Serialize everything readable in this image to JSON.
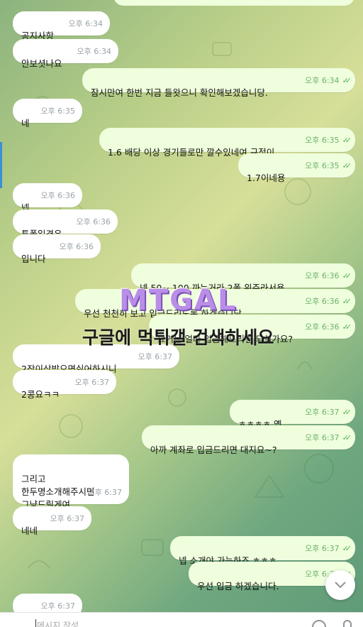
{
  "messages": [
    {
      "dir": "in",
      "text": "공지사항",
      "time": "오후 6:34"
    },
    {
      "dir": "in",
      "text": "안보셧나요",
      "time": "오후 6:34"
    },
    {
      "dir": "out",
      "text": "잠시만여 한번 지금 들왓으니 확인해보겠습니당.",
      "time": "오후 6:34"
    },
    {
      "dir": "in",
      "text": "네",
      "time": "오후 6:35"
    },
    {
      "dir": "out",
      "text": "1.6 배당 이상 경기들로만 깔수있네여 규정이",
      "time": "오후 6:35"
    },
    {
      "dir": "out",
      "text": "1.7이네용",
      "time": "오후 6:35"
    },
    {
      "dir": "in",
      "text": "넵",
      "time": "오후 6:36"
    },
    {
      "dir": "in",
      "text": "투폴일경우",
      "time": "오후 6:36"
    },
    {
      "dir": "in",
      "text": "입니다",
      "time": "오후 6:36"
    },
    {
      "dir": "out",
      "text": "넹 50~ 100 까는거라 2폴 위주라서용",
      "time": "오후 6:36"
    },
    {
      "dir": "out",
      "text": "우선 천천히 보고 입금드리도록 하겠습니당.",
      "time": "오후 6:36"
    },
    {
      "dir": "out",
      "text": "요거는 얼마 입금해드리면 되실가요?",
      "time": "오후 6:36"
    },
    {
      "dir": "in",
      "text": "2장이상받으면싫어하시니",
      "time": "오후 6:37"
    },
    {
      "dir": "in",
      "text": "2콩요ㅋㅋ",
      "time": "오후 6:37"
    },
    {
      "dir": "out",
      "text": "ㅎㅎㅎㅎ 옙",
      "time": "오후 6:37"
    },
    {
      "dir": "out",
      "text": "아까 계좌로 입금드리면 대지요~?",
      "time": "오후 6:37"
    },
    {
      "dir": "in",
      "text": "그리고\n한두명소개해주시면\n그냥드릴게여",
      "time": "오후 6:37"
    },
    {
      "dir": "in",
      "text": "네네",
      "time": "오후 6:37"
    },
    {
      "dir": "out",
      "text": "넵 소개야 가능하죠 ㅎㅎㅎ",
      "time": "오후 6:37"
    },
    {
      "dir": "out",
      "text": "우선 입금 하겠습니다.",
      "time": "오후 6:37"
    },
    {
      "dir": "in",
      "text": "네",
      "time": "오후 6:37"
    }
  ],
  "watermark": {
    "logo": "MTGAL",
    "text": "구글에 먹튀갤 검색하세요"
  },
  "composer": {
    "placeholder": "메시지 작성"
  },
  "icons": {
    "scroll_down": "chevron-down-icon",
    "emoji": "smile-icon",
    "mic": "microphone-icon",
    "read": "double-check-icon"
  },
  "colors": {
    "incoming": "#ffffff",
    "outgoing": "#effedd",
    "check": "#53b35a"
  }
}
